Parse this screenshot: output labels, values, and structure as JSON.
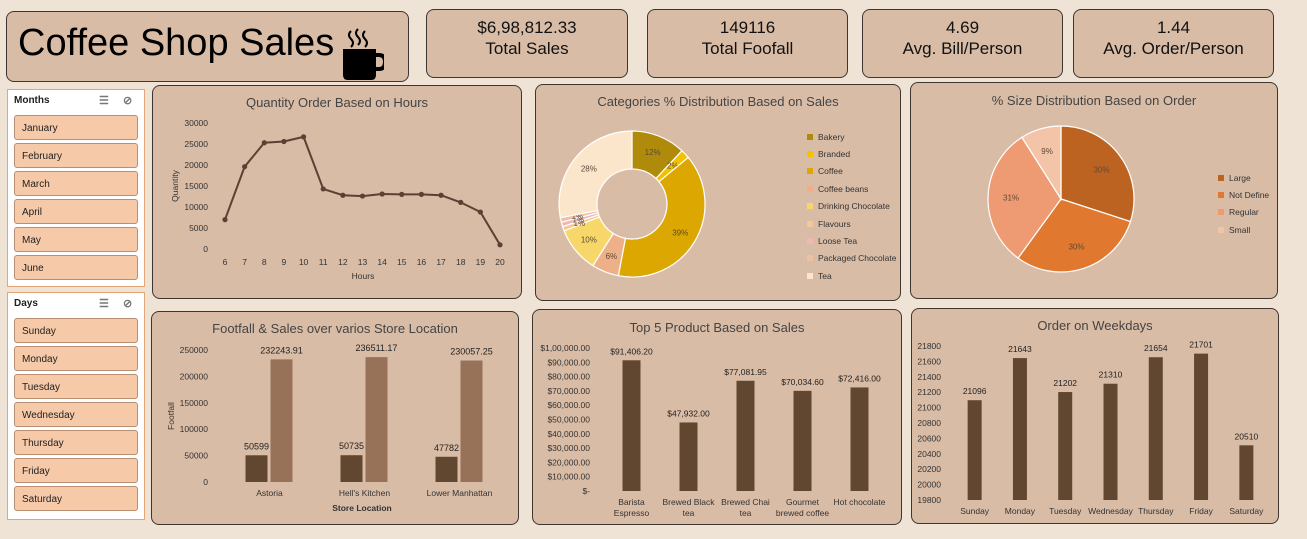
{
  "title": "Coffee Shop Sales",
  "kpis": [
    {
      "value": "$6,98,812.33",
      "label": "Total Sales"
    },
    {
      "value": "149116",
      "label": "Total Foofall"
    },
    {
      "value": "4.69",
      "label": "Avg. Bill/Person"
    },
    {
      "value": "1.44",
      "label": "Avg. Order/Person"
    }
  ],
  "months_slicer": {
    "title": "Months",
    "items": [
      "January",
      "February",
      "March",
      "April",
      "May",
      "June"
    ]
  },
  "days_slicer": {
    "title": "Days",
    "items": [
      "Sunday",
      "Monday",
      "Tuesday",
      "Wednesday",
      "Thursday",
      "Friday",
      "Saturday"
    ]
  },
  "colors": {
    "bg": "#efe3d6",
    "panel": "#d9bca6",
    "line": "#5c4033",
    "bar_dark": "#614630",
    "bar_light": "#977259"
  },
  "charts": {
    "hours": {
      "title": "Quantity Order Based on Hours",
      "chart_data": {
        "type": "line",
        "x": [
          6,
          7,
          8,
          9,
          10,
          11,
          12,
          13,
          14,
          15,
          16,
          17,
          18,
          19,
          20
        ],
        "values": [
          7000,
          19600,
          25300,
          25600,
          26700,
          14300,
          12800,
          12600,
          13100,
          13000,
          13000,
          12800,
          11100,
          8800,
          1000
        ],
        "xlabel": "Hours",
        "ylabel": "Quantity",
        "yticks": [
          "0",
          "5000",
          "10000",
          "15000",
          "20000",
          "25000",
          "30000"
        ],
        "ylim": [
          0,
          30000
        ]
      }
    },
    "categories": {
      "title": "Categories % Distribution Based on Sales",
      "chart_data": {
        "type": "pie",
        "donut": true,
        "labels": [
          "Bakery",
          "Branded",
          "Coffee",
          "Coffee beans",
          "Drinking Chocolate",
          "Flavours",
          "Loose Tea",
          "Packaged Chocolate",
          "Tea"
        ],
        "values": [
          12,
          2,
          39,
          6,
          10,
          1,
          1,
          1,
          28
        ],
        "colors": [
          "#b08a0a",
          "#f2c200",
          "#dba700",
          "#eeb088",
          "#f8d76a",
          "#f5c89a",
          "#f1b7b7",
          "#f0c0a4",
          "#fbe6cc"
        ],
        "label_text": [
          "12%",
          "2%",
          "39%",
          "6%",
          "10%",
          "1%",
          "1%",
          "1%",
          "28%"
        ]
      }
    },
    "size": {
      "title": "% Size Distribution Based on Order",
      "chart_data": {
        "type": "pie",
        "labels": [
          "Large",
          "Not Define",
          "Regular",
          "Small"
        ],
        "values": [
          30,
          30,
          31,
          9
        ],
        "colors": [
          "#bd6321",
          "#e0792f",
          "#ee9b73",
          "#f3c4a7"
        ],
        "label_text": [
          "30%",
          "30%",
          "31%",
          "9%"
        ]
      }
    },
    "footfall": {
      "title": "Footfall & Sales over varios Store Location",
      "chart_data": {
        "type": "bar",
        "categories": [
          "Astoria",
          "Hell's Kitchen",
          "Lower Manhattan"
        ],
        "series": [
          {
            "values": [
              50599,
              50735,
              47782
            ]
          },
          {
            "values": [
              232243.91,
              236511.17,
              230057.25
            ]
          }
        ],
        "value_labels": [
          [
            "50599",
            "50735",
            "47782"
          ],
          [
            "232243.91",
            "236511.17",
            "230057.25"
          ]
        ],
        "xlabel": "Store Location",
        "ylabel": "Footfall",
        "yticks": [
          "0",
          "50000",
          "100000",
          "150000",
          "200000",
          "250000"
        ],
        "ylim": [
          0,
          250000
        ]
      }
    },
    "products": {
      "title": "Top 5 Product Based on Sales",
      "chart_data": {
        "type": "bar",
        "categories": [
          [
            "Barista",
            "Espresso"
          ],
          [
            "Brewed Black",
            "tea"
          ],
          [
            "Brewed Chai",
            "tea"
          ],
          [
            "Gourmet",
            "brewed coffee"
          ],
          [
            "Hot chocolate"
          ]
        ],
        "values": [
          91406.2,
          47932.0,
          77081.95,
          70034.6,
          72416.0
        ],
        "value_labels": [
          "$91,406.20",
          "$47,932.00",
          "$77,081.95",
          "$70,034.60",
          "$72,416.00"
        ],
        "yticks": [
          "$-",
          "$10,000.00",
          "$20,000.00",
          "$30,000.00",
          "$40,000.00",
          "$50,000.00",
          "$60,000.00",
          "$70,000.00",
          "$80,000.00",
          "$90,000.00",
          "$1,00,000.00"
        ],
        "ylim": [
          0,
          100000
        ]
      }
    },
    "weekdays": {
      "title": "Order on Weekdays",
      "chart_data": {
        "type": "bar",
        "categories": [
          "Sunday",
          "Monday",
          "Tuesday",
          "Wednesday",
          "Thursday",
          "Friday",
          "Saturday"
        ],
        "values": [
          21096,
          21643,
          21202,
          21310,
          21654,
          21701,
          20510
        ],
        "value_labels": [
          "21096",
          "21643",
          "21202",
          "21310",
          "21654",
          "21701",
          "20510"
        ],
        "yticks": [
          "19800",
          "20000",
          "20200",
          "20400",
          "20600",
          "20800",
          "21000",
          "21200",
          "21400",
          "21600",
          "21800"
        ],
        "ylim": [
          19800,
          21800
        ]
      }
    }
  }
}
